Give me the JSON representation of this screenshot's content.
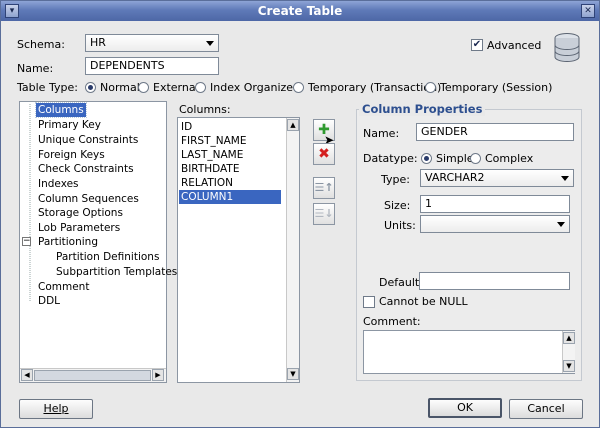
{
  "window": {
    "title": "Create Table"
  },
  "schema": {
    "label": "Schema:",
    "value": "HR"
  },
  "name": {
    "label": "Name:",
    "value": "DEPENDENTS"
  },
  "advanced": {
    "label": "Advanced",
    "checked": true
  },
  "table_type": {
    "label": "Table Type:",
    "options": [
      "Normal",
      "External",
      "Index Organized",
      "Temporary (Transaction)",
      "Temporary (Session)"
    ],
    "selected": "Normal"
  },
  "tree": {
    "items": [
      "Columns",
      "Primary Key",
      "Unique Constraints",
      "Foreign Keys",
      "Check Constraints",
      "Indexes",
      "Column Sequences",
      "Storage Options",
      "Lob Parameters",
      "Partitioning",
      "Partition Definitions",
      "Subpartition Templates",
      "Comment",
      "DDL"
    ],
    "selected": "Columns"
  },
  "columns": {
    "label": "Columns:",
    "items": [
      "ID",
      "FIRST_NAME",
      "LAST_NAME",
      "BIRTHDATE",
      "RELATION",
      "COLUMN1"
    ],
    "selected": "COLUMN1"
  },
  "tools": {
    "add_icon": "plus-icon",
    "remove_icon": "x-icon",
    "move_up_icon": "move-up-icon",
    "move_down_icon": "move-down-icon"
  },
  "props": {
    "title": "Column Properties",
    "name_label": "Name:",
    "name_value": "GENDER",
    "datatype_label": "Datatype:",
    "simple": "Simple",
    "complex": "Complex",
    "type_label": "Type:",
    "type_value": "VARCHAR2",
    "size_label": "Size:",
    "size_value": "1",
    "units_label": "Units:",
    "units_value": "",
    "default_label": "Default:",
    "default_value": "",
    "notnull_label": "Cannot be NULL",
    "comment_label": "Comment:"
  },
  "buttons": {
    "help": "Help",
    "ok": "OK",
    "cancel": "Cancel"
  },
  "colors": {
    "accent": "#3a66c0",
    "title_bar": "#5f7ab8",
    "group_title": "#2d4f8f"
  }
}
